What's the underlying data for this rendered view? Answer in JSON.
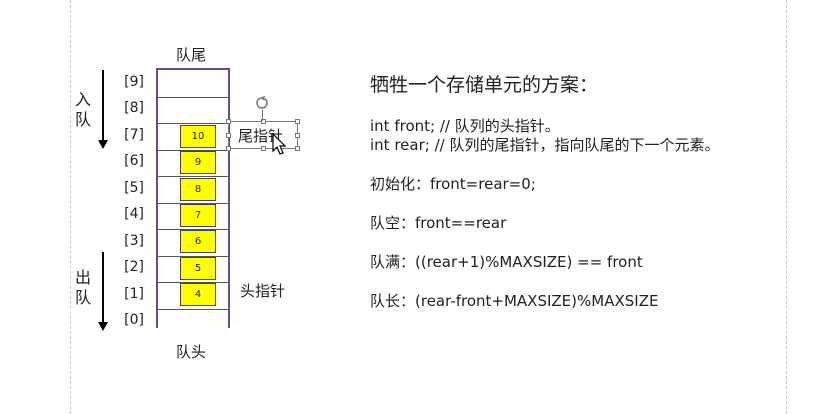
{
  "diagram": {
    "top_label": "队尾",
    "bottom_label": "队头",
    "enqueue_label": "入队",
    "dequeue_label": "出队",
    "indices": [
      "[9]",
      "[8]",
      "[7]",
      "[6]",
      "[5]",
      "[4]",
      "[3]",
      "[2]",
      "[1]",
      "[0]"
    ],
    "cells": [
      "10",
      "9",
      "8",
      "7",
      "6",
      "5",
      "4"
    ],
    "rear_pointer_label": "尾指针",
    "front_pointer_label": "头指针"
  },
  "content": {
    "heading": "牺牲一个存储单元的方案：",
    "line_front": "int front;  // 队列的头指针。",
    "line_rear": "int rear;    // 队列的尾指针，指向队尾的下一个元素。",
    "init": "初始化：front=rear=0;",
    "empty": "队空：front==rear",
    "full": "队满：((rear+1)%MAXSIZE) == front",
    "length": "队长：(rear-front+MAXSIZE)%MAXSIZE"
  }
}
